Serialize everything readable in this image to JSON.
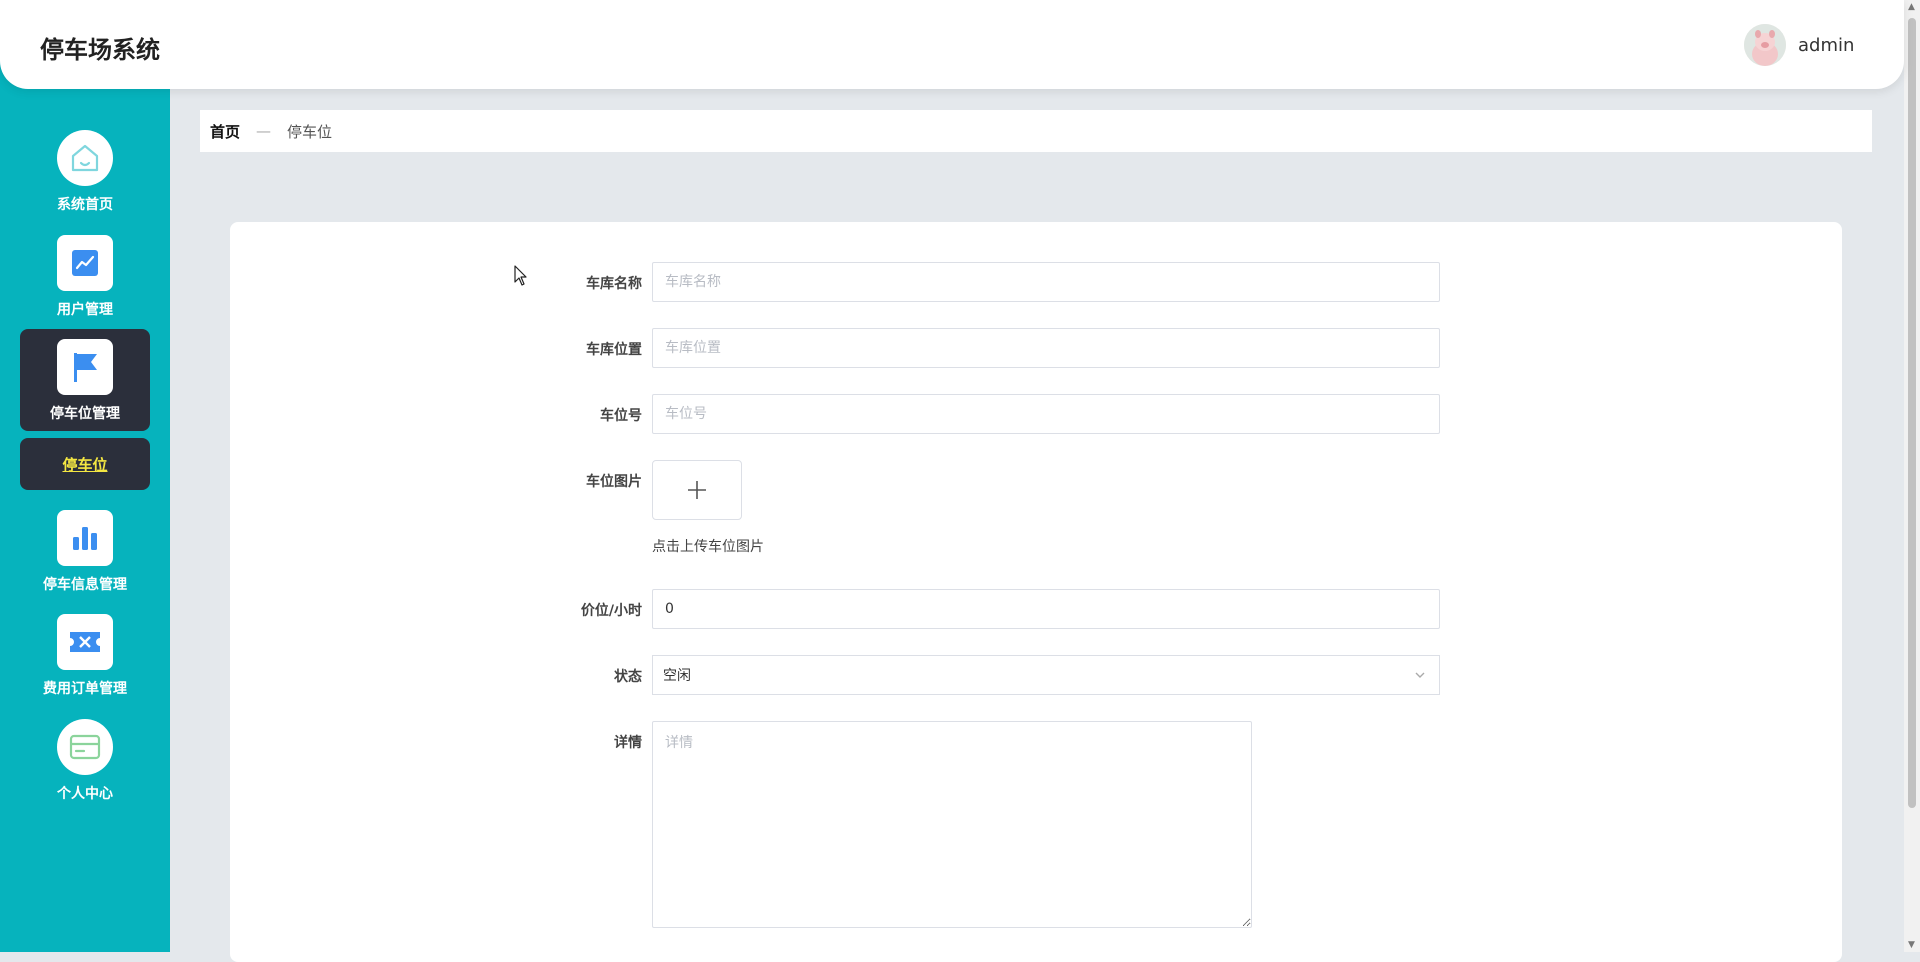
{
  "header": {
    "title": "停车场系统",
    "username": "admin"
  },
  "sidebar": {
    "items": [
      {
        "label": "系统首页",
        "icon": "home-icon"
      },
      {
        "label": "用户管理",
        "icon": "chart-icon"
      },
      {
        "label": "停车位管理",
        "icon": "flag-icon"
      },
      {
        "label": "停车信息管理",
        "icon": "bar-chart-icon"
      },
      {
        "label": "费用订单管理",
        "icon": "ticket-icon"
      },
      {
        "label": "个人中心",
        "icon": "card-icon"
      }
    ],
    "active_sub": "停车位"
  },
  "breadcrumb": {
    "home": "首页",
    "separator": "—",
    "current": "停车位"
  },
  "form": {
    "garage_name": {
      "label": "车库名称",
      "placeholder": "车库名称",
      "value": ""
    },
    "garage_location": {
      "label": "车库位置",
      "placeholder": "车库位置",
      "value": ""
    },
    "spot_number": {
      "label": "车位号",
      "placeholder": "车位号",
      "value": ""
    },
    "spot_image": {
      "label": "车位图片",
      "hint": "点击上传车位图片"
    },
    "price": {
      "label": "价位/小时",
      "value": "0"
    },
    "status": {
      "label": "状态",
      "value": "空闲"
    },
    "details": {
      "label": "详情",
      "placeholder": "详情"
    }
  },
  "colors": {
    "sidebar": "#06b3bd",
    "active": "#2b2f3b",
    "sub_text": "#f4e742",
    "icon": "#3b8ef0"
  }
}
